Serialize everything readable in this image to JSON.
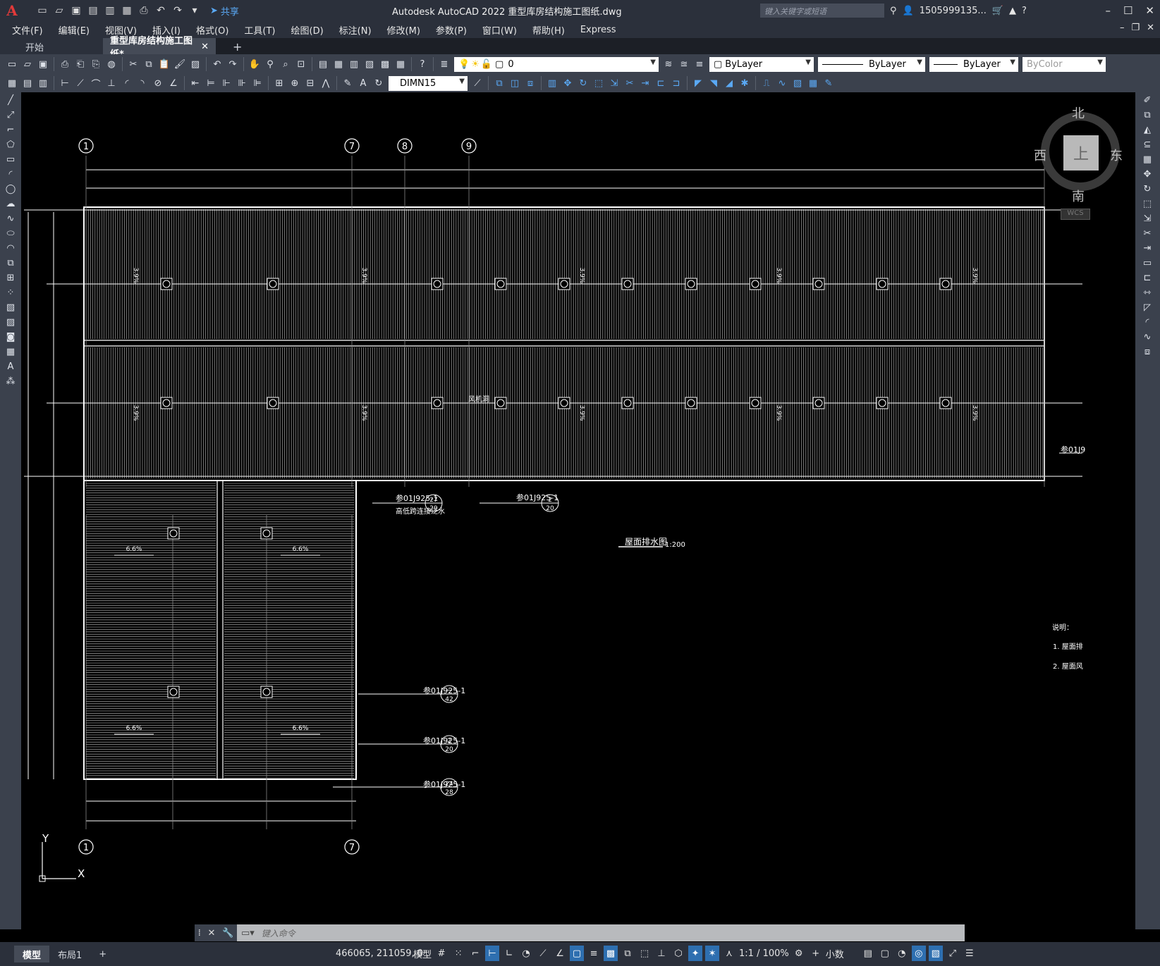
{
  "titlebar": {
    "logo": "A",
    "share": "共享",
    "title": "Autodesk AutoCAD 2022    重型库房结构施工图纸.dwg",
    "search_placeholder": "键入关键字或短语",
    "user": "1505999135...",
    "window_controls": [
      "–",
      "☐",
      "✕"
    ]
  },
  "menubar": {
    "items": [
      "文件(F)",
      "编辑(E)",
      "视图(V)",
      "插入(I)",
      "格式(O)",
      "工具(T)",
      "绘图(D)",
      "标注(N)",
      "修改(M)",
      "参数(P)",
      "窗口(W)",
      "帮助(H)",
      "Express"
    ]
  },
  "tabs": {
    "start": "开始",
    "document": "重型库房结构施工图纸*",
    "add": "+"
  },
  "toolbar": {
    "layer_value": "0",
    "color_value": "ByLayer",
    "linetype_value": "ByLayer",
    "lineweight_value": "ByLayer",
    "plotstyle_value": "ByColor",
    "dimstyle_value": "DIMN15"
  },
  "viewcube": {
    "north": "北",
    "south": "南",
    "east": "东",
    "west": "西",
    "face": "上",
    "wcs": "WCS"
  },
  "drawing": {
    "grid_top": [
      "1",
      "7",
      "8",
      "9"
    ],
    "grid_bottom": [
      "1",
      "7"
    ],
    "fan_label": "风机洞",
    "slope_top": [
      "3.9%",
      "3.9%",
      "3.9%",
      "3.9%",
      "3.9%"
    ],
    "slope_bottom": [
      "6.6%",
      "6.6%",
      "6.6%",
      "6.6%"
    ],
    "callouts": [
      {
        "ref": "参01J925-1",
        "top": "27",
        "bottom": "29",
        "note": "高低跨连接泛水"
      },
      {
        "ref": "参01J925-1",
        "top": "2",
        "bottom": "20",
        "note": ""
      },
      {
        "ref": "参01J925-1",
        "top": "一",
        "bottom": "42",
        "note": ""
      },
      {
        "ref": "参01J925-1",
        "top": "2",
        "bottom": "20",
        "note": ""
      },
      {
        "ref": "参01J925-1",
        "top": "24",
        "bottom": "28",
        "note": ""
      }
    ],
    "right_ref": "参01J9",
    "plan_title": "屋面排水图",
    "plan_scale": "1:200",
    "notes_title": "说明：",
    "notes": [
      "1. 屋面排",
      "2. 屋面风"
    ],
    "ucs_y": "Y",
    "ucs_x": "X"
  },
  "command": {
    "placeholder": "键入命令"
  },
  "statusbar": {
    "model_tab": "模型",
    "layout_tab": "布局1",
    "add_tab": "+",
    "coords": "466065, 211059, 0",
    "model_label": "模型",
    "scale": "1:1 / 100%",
    "units": "小数"
  },
  "colors": {
    "app_bg": "#2b303b",
    "toolbar_bg": "#3b414d",
    "canvas_bg": "#000000",
    "accent": "#2e6fb0"
  }
}
